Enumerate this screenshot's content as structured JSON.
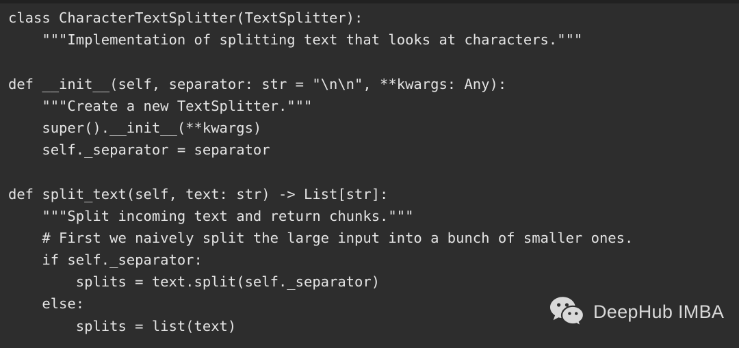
{
  "window": {
    "background_color": "#2d2d2d",
    "top_edge_color": "#212121"
  },
  "code": {
    "language": "python",
    "text_color": "#e4e4e4",
    "lines": [
      "class CharacterTextSplitter(TextSplitter):",
      "    \"\"\"Implementation of splitting text that looks at characters.\"\"\"",
      "",
      "def __init__(self, separator: str = \"\\n\\n\", **kwargs: Any):",
      "    \"\"\"Create a new TextSplitter.\"\"\"",
      "    super().__init__(**kwargs)",
      "    self._separator = separator",
      "",
      "def split_text(self, text: str) -> List[str]:",
      "    \"\"\"Split incoming text and return chunks.\"\"\"",
      "    # First we naively split the large input into a bunch of smaller ones.",
      "    if self._separator:",
      "        splits = text.split(self._separator)",
      "    else:",
      "        splits = list(text)"
    ]
  },
  "watermark": {
    "icon": "wechat-icon",
    "label": "DeepHub IMBA",
    "label_color": "#e8e8e8",
    "icon_color": "#e8e8e8"
  }
}
